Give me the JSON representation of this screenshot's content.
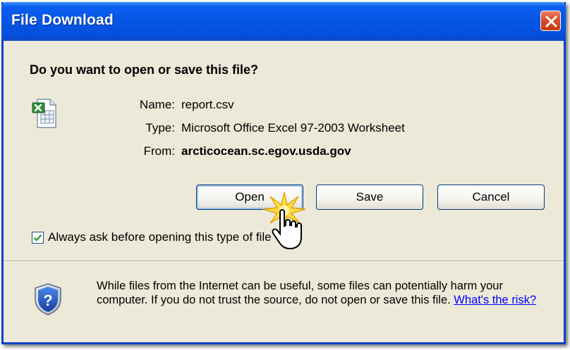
{
  "dialog": {
    "title": "File Download",
    "question": "Do you want to open or save this file?"
  },
  "file": {
    "icon": "excel-file-icon",
    "name_label": "Name:",
    "name": "report.csv",
    "type_label": "Type:",
    "type": "Microsoft Office Excel 97-2003 Worksheet",
    "from_label": "From:",
    "from": "arcticocean.sc.egov.usda.gov"
  },
  "buttons": {
    "open": "Open",
    "save": "Save",
    "cancel": "Cancel"
  },
  "checkbox": {
    "label": "Always ask before opening this type of file",
    "checked": true
  },
  "warning": {
    "icon": "security-shield-question-icon",
    "text": "While files from the Internet can be useful, some files can potentially harm your computer. If you do not trust the source, do not open or save this file.",
    "link": "What's the risk?"
  },
  "colors": {
    "titlebar": "#0655e4",
    "close": "#dc4b25",
    "dialog_bg": "#ece9d8",
    "link": "#0000ff"
  }
}
